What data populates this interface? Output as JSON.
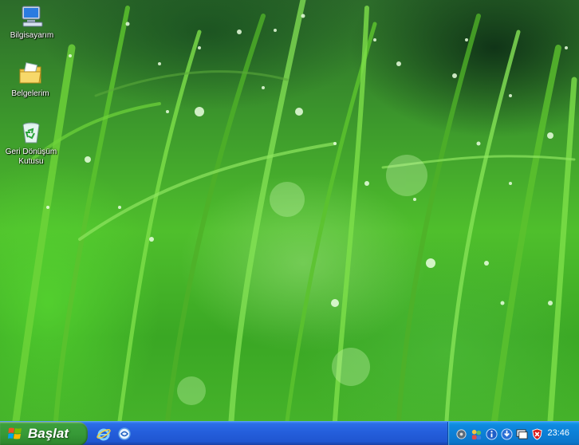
{
  "desktop": {
    "icons": [
      {
        "label": "Bilgisayarım",
        "icon": "my-computer-icon"
      },
      {
        "label": "Belgelerim",
        "icon": "my-documents-icon"
      },
      {
        "label": "Geri Dönüşüm Kutusu",
        "icon": "recycle-bin-icon"
      }
    ]
  },
  "taskbar": {
    "start_label": "Başlat",
    "quick_launch": [
      {
        "icon": "internet-explorer-icon"
      },
      {
        "icon": "outlook-express-icon"
      }
    ],
    "tray": {
      "icons": [
        {
          "icon": "network-icon"
        },
        {
          "icon": "people-icon"
        },
        {
          "icon": "info-icon"
        },
        {
          "icon": "update-icon"
        },
        {
          "icon": "display-icon"
        },
        {
          "icon": "security-shield-icon"
        }
      ],
      "clock": "23:46"
    }
  },
  "colors": {
    "taskbar_blue": "#245edb",
    "start_green": "#379a37",
    "tray_blue": "#0c7fd6",
    "grass_green": "#4fbf2c"
  }
}
